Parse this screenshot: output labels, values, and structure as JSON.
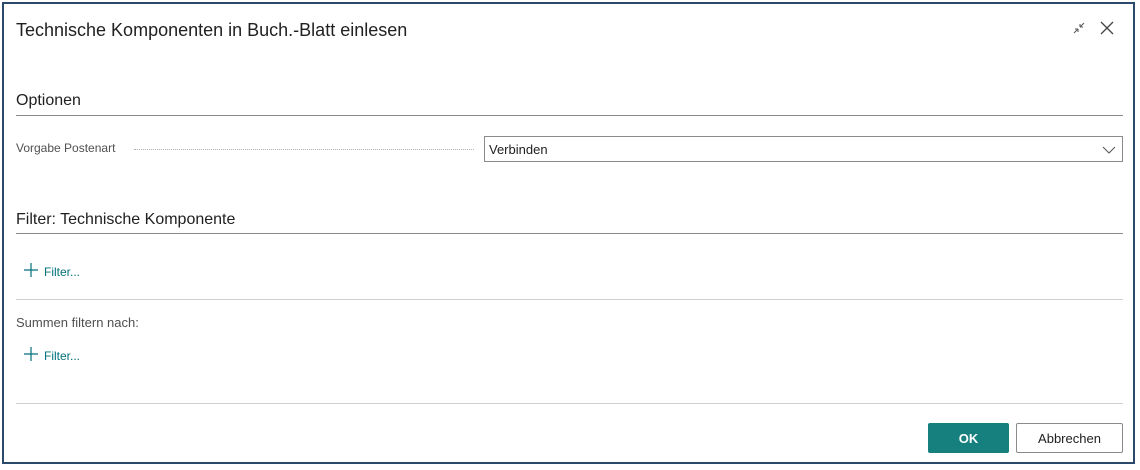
{
  "dialog": {
    "title": "Technische Komponenten in Buch.-Blatt einlesen"
  },
  "options": {
    "heading": "Optionen",
    "field_label": "Vorgabe Postenart",
    "field_value": "Verbinden"
  },
  "filter_section": {
    "heading": "Filter: Technische Komponente",
    "add_filter_label": "Filter..."
  },
  "totals_section": {
    "label": "Summen filtern nach:",
    "add_filter_label": "Filter..."
  },
  "buttons": {
    "ok": "OK",
    "cancel": "Abbrechen"
  },
  "icons": [
    "collapse-icon",
    "close-icon",
    "chevron-down-icon",
    "plus-icon"
  ],
  "colors": {
    "accent": "#15807e",
    "link": "#00707a",
    "border": "#2b4a6b"
  }
}
